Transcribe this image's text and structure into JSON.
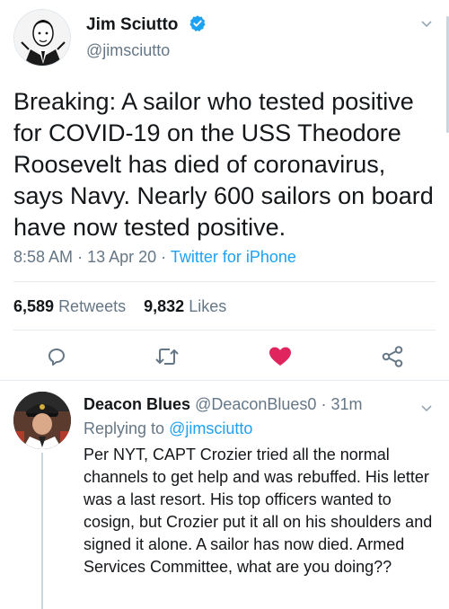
{
  "tweet": {
    "author_name": "Jim Sciutto",
    "author_handle": "@jimsciutto",
    "verified": true,
    "text": "Breaking: A sailor who tested positive for COVID-19 on the USS Theodore Roosevelt has died of coronavirus, says Navy. Nearly 600 sailors on board have now tested positive.",
    "time": "8:58 AM",
    "date": "13 Apr 20",
    "source": "Twitter for iPhone",
    "separator": "·",
    "retweets_count": "6,589",
    "retweets_label": "Retweets",
    "likes_count": "9,832",
    "likes_label": "Likes",
    "liked": true
  },
  "actions": {
    "reply_icon": "reply-icon",
    "retweet_icon": "retweet-icon",
    "like_icon": "heart-icon",
    "share_icon": "share-icon"
  },
  "reply": {
    "author_name": "Deacon Blues",
    "author_handle": "@DeaconBlues0",
    "time": "31m",
    "separator": "·",
    "replying_label": "Replying to",
    "replying_to": "@jimsciutto",
    "text": "Per NYT, CAPT Crozier tried all the normal channels to get help and was rebuffed. His letter was a last resort. His top officers wanted to cosign, but Crozier put it all on his shoulders and signed it alone.  A sailor has now died. Armed Services Committee, what are you doing??"
  },
  "colors": {
    "accent": "#1da1f2",
    "like": "#e0245e",
    "secondary_text": "#657786",
    "primary_text": "#14171a"
  }
}
